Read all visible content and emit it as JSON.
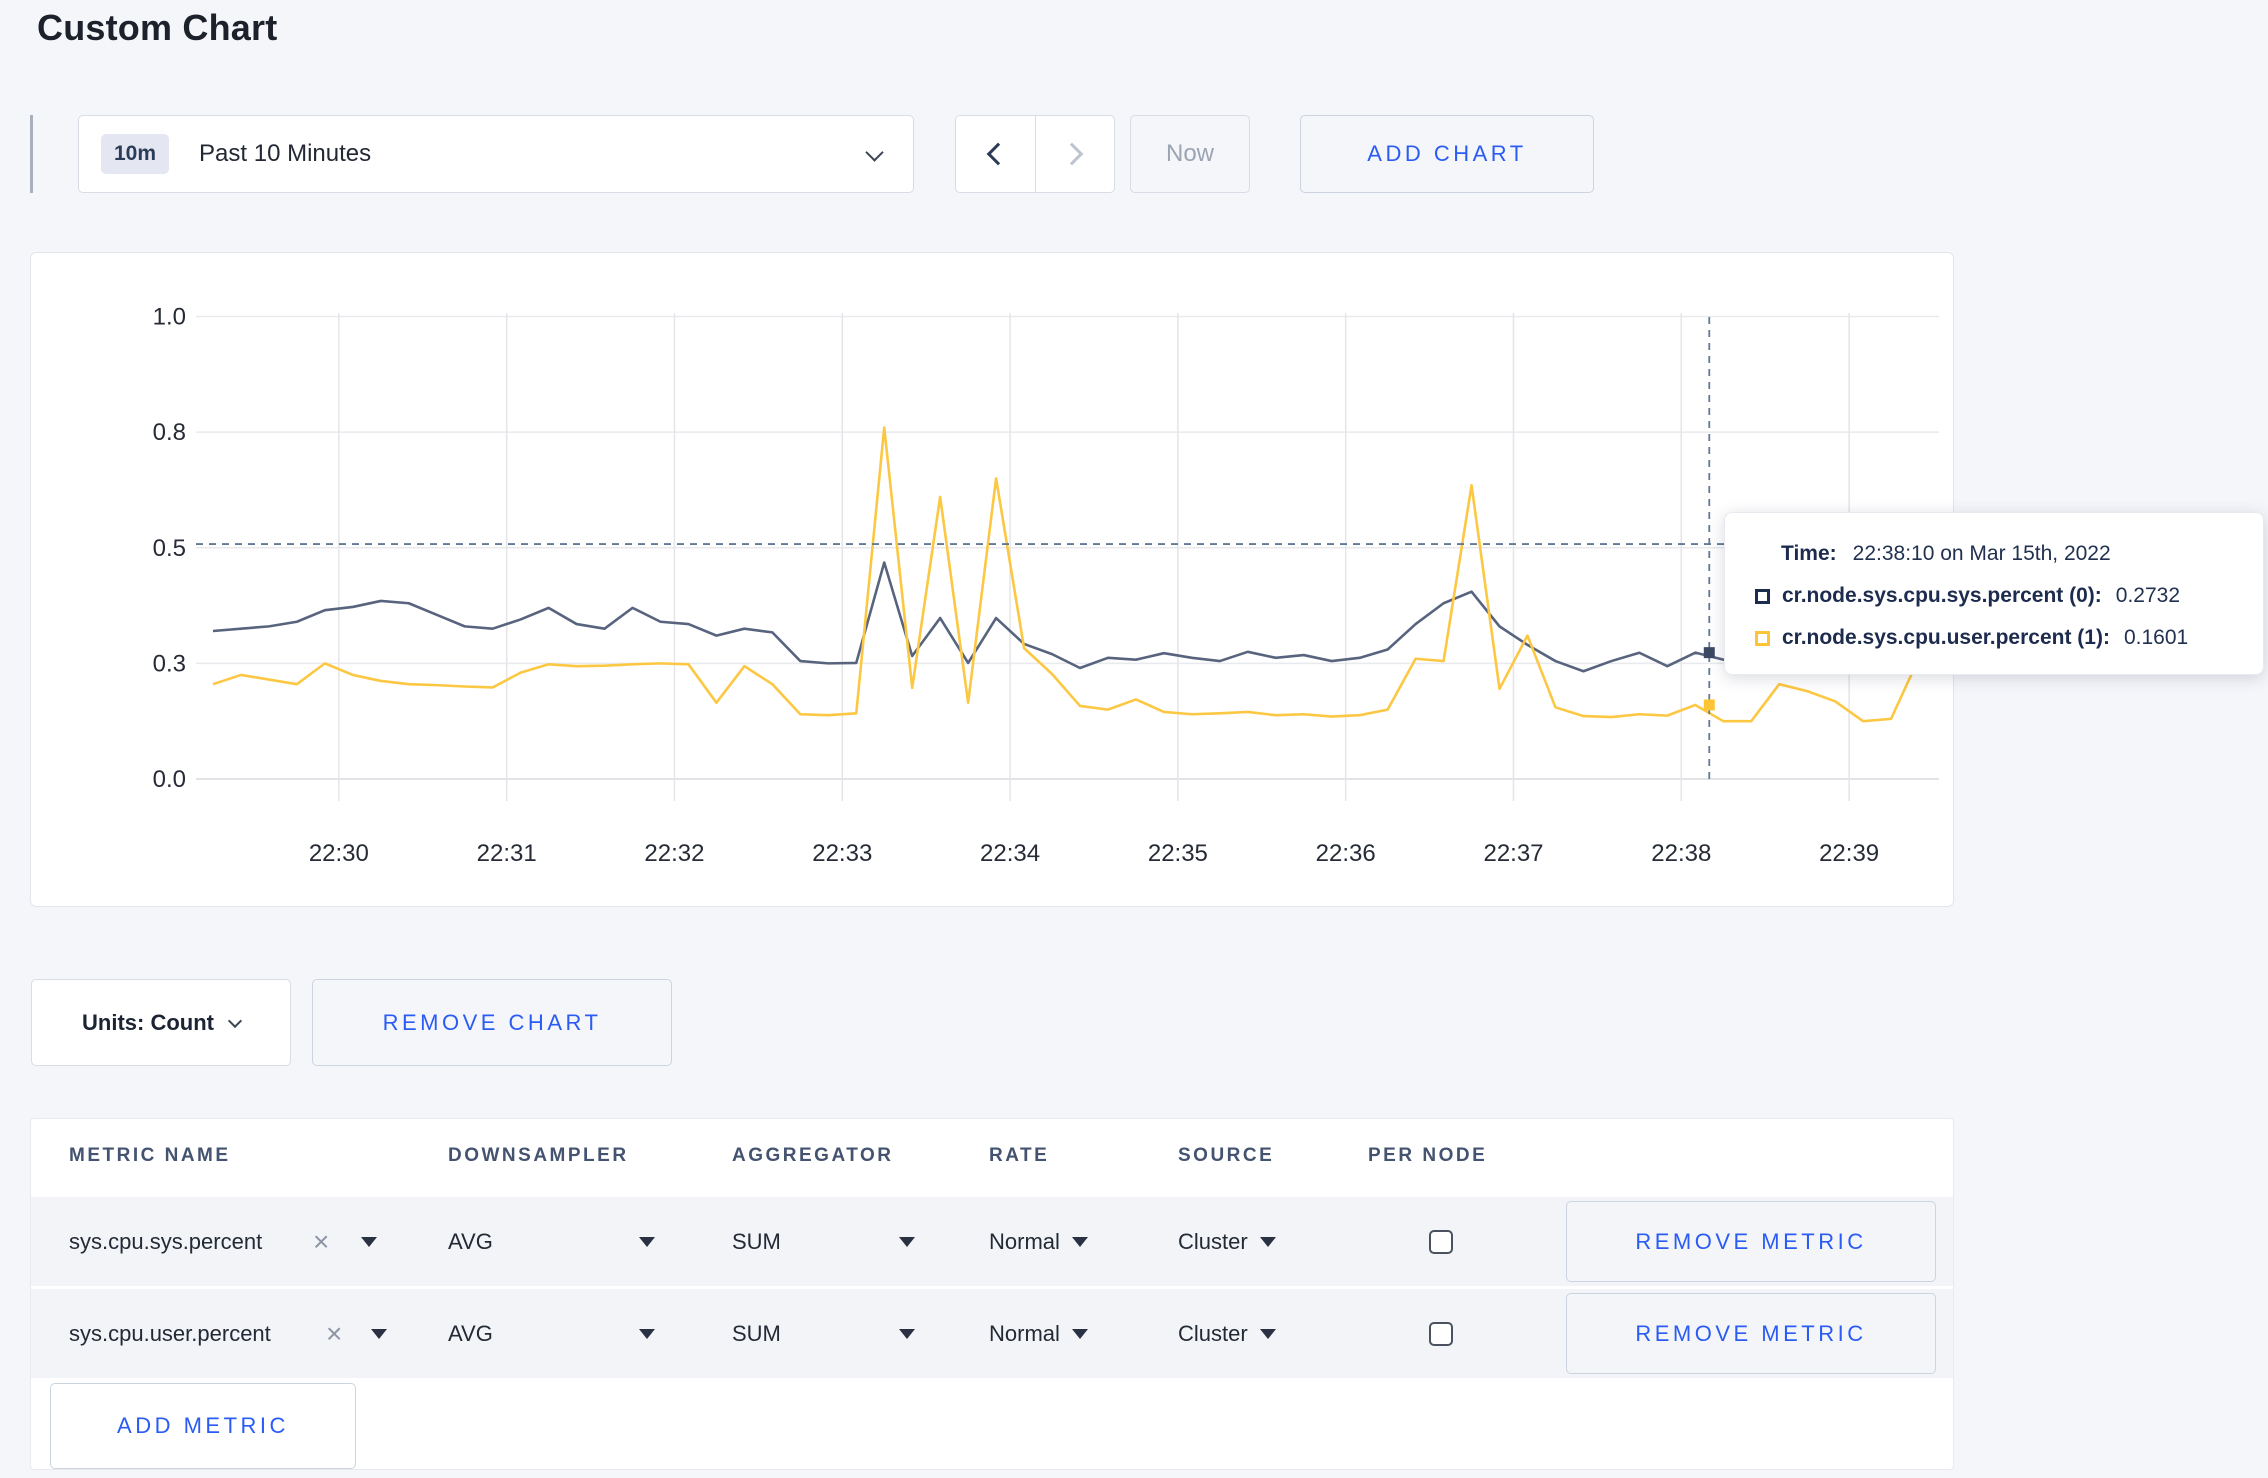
{
  "page": {
    "title": "Custom Chart"
  },
  "toolbar": {
    "time_badge": "10m",
    "time_label": "Past 10 Minutes",
    "now_label": "Now",
    "add_chart_label": "ADD CHART",
    "icons": {
      "dropdown": "chevron-down",
      "prev": "chevron-left",
      "next": "chevron-right"
    }
  },
  "chart_data": {
    "type": "line",
    "title": "",
    "xlabel": "",
    "ylabel": "",
    "ylim": [
      0,
      1
    ],
    "grid": true,
    "y_ticks": [
      {
        "v": 0.0,
        "label": "0.0"
      },
      {
        "v": 0.25,
        "label": "0.3"
      },
      {
        "v": 0.5,
        "label": "0.5"
      },
      {
        "v": 0.75,
        "label": "0.8"
      },
      {
        "v": 1.0,
        "label": "1.0"
      }
    ],
    "x_axis": {
      "t_start_s": -45,
      "t_step_s": 10,
      "ticks": [
        {
          "t": 0,
          "label": "22:30"
        },
        {
          "t": 60,
          "label": "22:31"
        },
        {
          "t": 120,
          "label": "22:32"
        },
        {
          "t": 180,
          "label": "22:33"
        },
        {
          "t": 240,
          "label": "22:34"
        },
        {
          "t": 300,
          "label": "22:35"
        },
        {
          "t": 360,
          "label": "22:36"
        },
        {
          "t": 420,
          "label": "22:37"
        },
        {
          "t": 480,
          "label": "22:38"
        },
        {
          "t": 540,
          "label": "22:39"
        }
      ]
    },
    "series": [
      {
        "name": "cr.node.sys.cpu.sys.percent",
        "color": "#58647e",
        "values": [
          0.32,
          0.325,
          0.33,
          0.34,
          0.365,
          0.372,
          0.385,
          0.38,
          0.355,
          0.33,
          0.325,
          0.345,
          0.37,
          0.335,
          0.325,
          0.37,
          0.34,
          0.335,
          0.31,
          0.325,
          0.317,
          0.255,
          0.25,
          0.251,
          0.468,
          0.266,
          0.348,
          0.251,
          0.348,
          0.292,
          0.27,
          0.24,
          0.262,
          0.258,
          0.272,
          0.262,
          0.255,
          0.275,
          0.262,
          0.268,
          0.255,
          0.262,
          0.28,
          0.335,
          0.38,
          0.405,
          0.33,
          0.29,
          0.255,
          0.233,
          0.255,
          0.273,
          0.244,
          0.2732,
          0.258,
          0.26,
          0.268,
          0.262,
          0.27,
          0.285,
          0.295,
          0.29,
          0.295
        ]
      },
      {
        "name": "cr.node.sys.cpu.user.percent",
        "color": "#fcc843",
        "values": [
          0.205,
          0.225,
          0.215,
          0.205,
          0.25,
          0.225,
          0.212,
          0.205,
          0.203,
          0.2,
          0.198,
          0.23,
          0.248,
          0.244,
          0.245,
          0.248,
          0.25,
          0.248,
          0.165,
          0.244,
          0.205,
          0.14,
          0.138,
          0.142,
          0.76,
          0.197,
          0.61,
          0.165,
          0.65,
          0.283,
          0.227,
          0.158,
          0.15,
          0.172,
          0.145,
          0.14,
          0.142,
          0.145,
          0.138,
          0.14,
          0.135,
          0.138,
          0.15,
          0.26,
          0.255,
          0.635,
          0.195,
          0.31,
          0.155,
          0.136,
          0.134,
          0.14,
          0.137,
          0.1601,
          0.125,
          0.125,
          0.205,
          0.19,
          0.168,
          0.125,
          0.13,
          0.262,
          0.245
        ]
      }
    ],
    "crosshair": {
      "t_s": 490,
      "y_value": 0.508,
      "marker_values": [
        0.2732,
        0.1601
      ],
      "color": "#617a92"
    },
    "legend_position": "tooltip-only"
  },
  "tooltip": {
    "time_label": "Time:",
    "time_value": "22:38:10 on Mar 15th, 2022",
    "series": [
      {
        "label": "cr.node.sys.cpu.sys.percent (0):",
        "value": "0.2732",
        "swatch_color": "#1d2b4e"
      },
      {
        "label": "cr.node.sys.cpu.user.percent (1):",
        "value": "0.1601",
        "swatch_color": "#fdc435"
      }
    ]
  },
  "units": {
    "label": "Units: Count"
  },
  "remove_chart_label": "REMOVE CHART",
  "metrics_table": {
    "headers": [
      "METRIC NAME",
      "DOWNSAMPLER",
      "AGGREGATOR",
      "RATE",
      "SOURCE",
      "PER NODE"
    ],
    "rows": [
      {
        "name": "sys.cpu.sys.percent",
        "close": "×",
        "downsampler": "AVG",
        "aggregator": "SUM",
        "rate": "Normal",
        "source": "Cluster",
        "per_node_checked": false,
        "remove_label": "REMOVE METRIC"
      },
      {
        "name": "sys.cpu.user.percent",
        "close": "×",
        "downsampler": "AVG",
        "aggregator": "SUM",
        "rate": "Normal",
        "source": "Cluster",
        "per_node_checked": false,
        "remove_label": "REMOVE METRIC"
      }
    ],
    "add_metric_label": "ADD METRIC"
  },
  "colors": {
    "accent_blue": "#2a5cf5",
    "series_sys": "#58647e",
    "series_user": "#fcc843",
    "page_bg": "#f5f6fa"
  }
}
